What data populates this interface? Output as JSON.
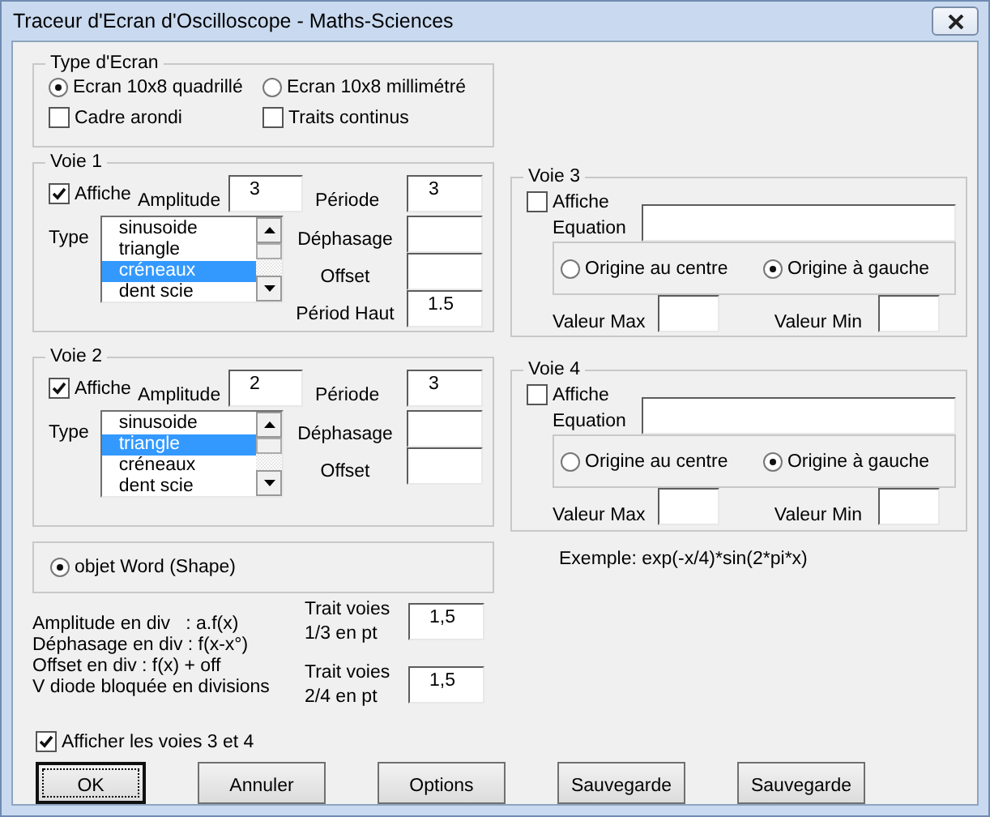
{
  "window": {
    "title": "Traceur d'Ecran d'Oscilloscope - Maths-Sciences"
  },
  "screen_type": {
    "title": "Type d'Ecran",
    "options": [
      {
        "label": "Ecran 10x8 quadrillé",
        "selected": true
      },
      {
        "label": "Ecran 10x8 millimétré",
        "selected": false
      }
    ],
    "checkboxes": [
      {
        "label": "Cadre arondi",
        "checked": false
      },
      {
        "label": "Traits continus",
        "checked": false
      }
    ]
  },
  "channels_left": [
    {
      "title": "Voie 1",
      "show": {
        "label": "Affiche",
        "checked": true
      },
      "amplitude": {
        "label": "Amplitude",
        "value": "3"
      },
      "period": {
        "label": "Période",
        "value": "3"
      },
      "type_label": "Type",
      "types": [
        {
          "label": "sinusoide",
          "selected": false
        },
        {
          "label": "triangle",
          "selected": false
        },
        {
          "label": "créneaux",
          "selected": true
        },
        {
          "label": "dent scie",
          "selected": false
        }
      ],
      "fields": [
        {
          "label": "Déphasage"
        },
        {
          "label": "Offset"
        },
        {
          "label": "Périod Haut",
          "value": "1.5"
        }
      ]
    },
    {
      "title": "Voie 2",
      "show": {
        "label": "Affiche",
        "checked": true
      },
      "amplitude": {
        "label": "Amplitude",
        "value": "2"
      },
      "period": {
        "label": "Période",
        "value": "3"
      },
      "type_label": "Type",
      "types": [
        {
          "label": "sinusoide",
          "selected": false
        },
        {
          "label": "triangle",
          "selected": true
        },
        {
          "label": "créneaux",
          "selected": false
        },
        {
          "label": "dent scie",
          "selected": false
        }
      ],
      "fields": [
        {
          "label": "Déphasage"
        },
        {
          "label": "Offset"
        }
      ]
    }
  ],
  "render_mode": {
    "label": "objet Word (Shape)",
    "selected": true
  },
  "channels_right": [
    {
      "title": "Voie 3",
      "show": {
        "label": "Affiche",
        "checked": false
      },
      "equation_label": "Equation",
      "origins": [
        {
          "label": "Origine au centre",
          "selected": false
        },
        {
          "label": "Origine à gauche",
          "selected": true
        }
      ],
      "max_label": "Valeur Max",
      "min_label": "Valeur Min"
    },
    {
      "title": "Voie 4",
      "show": {
        "label": "Affiche",
        "checked": false
      },
      "equation_label": "Equation",
      "origins": [
        {
          "label": "Origine au centre",
          "selected": false
        },
        {
          "label": "Origine à gauche",
          "selected": true
        }
      ],
      "max_label": "Valeur Max",
      "min_label": "Valeur Min"
    }
  ],
  "example": "Exemple: exp(-x/4)*sin(2*pi*x)",
  "help_lines": [
    "Amplitude en div   : a.f(x)",
    "Déphasage en div : f(x-x°)",
    "Offset en div : f(x) + off",
    "V diode bloquée en divisions"
  ],
  "line_widths": [
    {
      "label": "Trait voies 1/3 en pt",
      "value": "1,5"
    },
    {
      "label": "Trait voies 2/4 en pt",
      "value": "1,5"
    }
  ],
  "show_34": {
    "label": "Afficher les voies 3 et 4",
    "checked": true
  },
  "buttons": [
    {
      "label": "OK",
      "default": true
    },
    {
      "label": "Annuler",
      "default": false
    },
    {
      "label": "Options",
      "default": false
    },
    {
      "label": "Sauvegarde",
      "default": false
    },
    {
      "label": "Sauvegarde",
      "default": false
    }
  ]
}
